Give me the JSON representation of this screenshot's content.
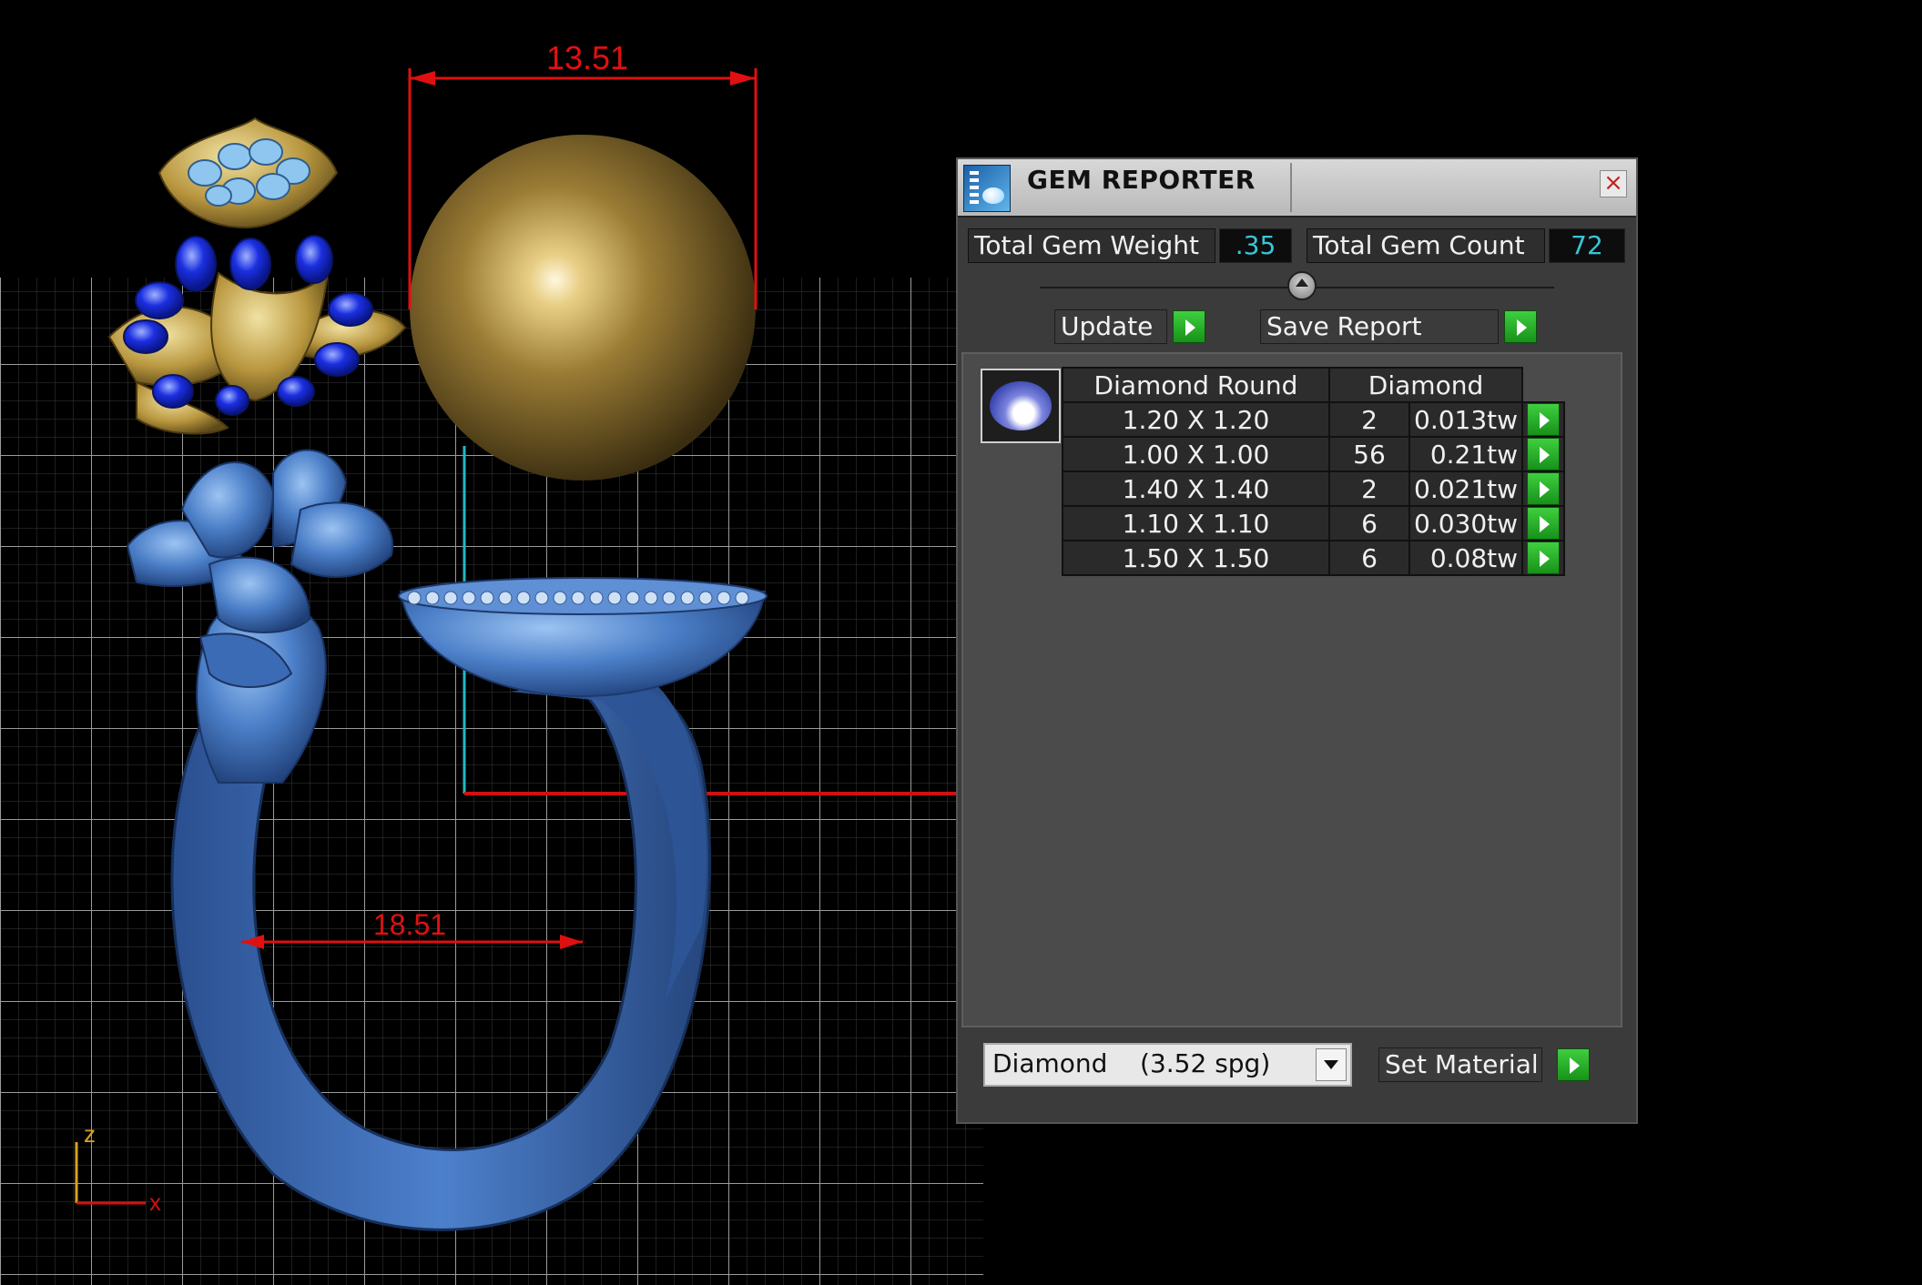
{
  "viewport": {
    "dimension_top": "13.51",
    "dimension_bottom": "18.51",
    "axis_z": "z",
    "axis_x": "x"
  },
  "panel": {
    "title": "GEM REPORTER",
    "close_glyph": "×",
    "total_weight_label": "Total Gem Weight",
    "total_weight_value": ".35",
    "total_count_label": "Total Gem Count",
    "total_count_value": "72",
    "update_label": "Update",
    "save_report_label": "Save Report",
    "table_header_shape": "Diamond Round",
    "table_header_material": "Diamond",
    "rows": [
      {
        "size": "1.20 X 1.20",
        "count": "2",
        "weight": "0.013tw"
      },
      {
        "size": "1.00 X 1.00",
        "count": "56",
        "weight": "0.21tw"
      },
      {
        "size": "1.40 X 1.40",
        "count": "2",
        "weight": "0.021tw"
      },
      {
        "size": "1.10 X 1.10",
        "count": "6",
        "weight": "0.030tw"
      },
      {
        "size": "1.50 X 1.50",
        "count": "6",
        "weight": "0.08tw"
      }
    ],
    "material_select": "Diamond    (3.52 spg)",
    "set_material_label": "Set Material"
  },
  "colors": {
    "background": "#000000",
    "grid": "#8a8a8a",
    "dimension": "#e01010",
    "ring": "#3f6fb8",
    "gold": "#a9883a",
    "accent_value": "#39c5d9",
    "go_button": "#2bb52e"
  }
}
